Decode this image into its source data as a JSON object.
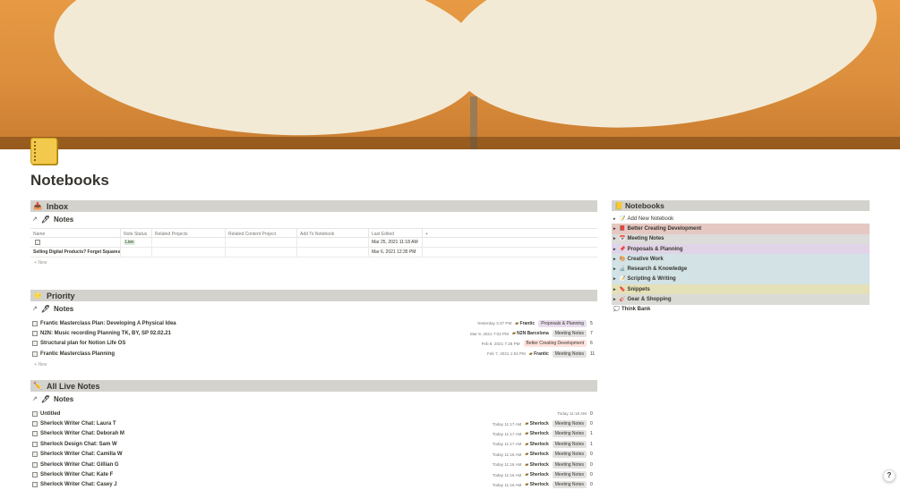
{
  "page": {
    "title": "Notebooks"
  },
  "inbox": {
    "heading": "Inbox",
    "heading_icon": "inbox-tray-icon",
    "view": "Notes",
    "columns": [
      "Name",
      "Note Status",
      "Related Projects",
      "Related Content Project",
      "Add To Notebook",
      "Last Edited"
    ],
    "rows": [
      {
        "name": "",
        "status": "Live",
        "edited": "Mar 25, 2021 11:18 AM"
      },
      {
        "name": "Selling Digital Products? Forget Squares",
        "status": "",
        "edited": "Mar 6, 2021 12:35 PM"
      }
    ],
    "new_label": "New"
  },
  "priority": {
    "heading": "Priority",
    "heading_icon": "star-icon",
    "view": "Notes",
    "rows": [
      {
        "title": "Frantic Masterclass Plan: Developing A Physical Idea",
        "date": "Yesterday 3:37 PM",
        "person": "Frantic",
        "tag": "Proposals & Planning",
        "tag_color": "#e8deee",
        "count": "5"
      },
      {
        "title": "N2N: Music recording Planning TK, BY, SP 02.02.21",
        "date": "Mar 9, 2021 7:02 PM",
        "person": "N2N Barcelona",
        "tag": "Meeting Notes",
        "tag_color": "#e3e2e0",
        "count": "7"
      },
      {
        "title": "Structural plan for Notion Life OS",
        "date": "Feb 8, 2021 7:28 PM",
        "person": "",
        "tag": "Better Creating Development",
        "tag_color": "#ffe2dd",
        "count": "6"
      },
      {
        "title": "Frantic Masterclass Planning",
        "date": "Feb 7, 2021 1:53 PM",
        "person": "Frantic",
        "tag": "Meeting Notes",
        "tag_color": "#e3e2e0",
        "count": "11"
      }
    ],
    "new_label": "New"
  },
  "all_live": {
    "heading": "All Live Notes",
    "heading_icon": "pencil-icon",
    "view": "Notes",
    "rows": [
      {
        "title": "Untitled",
        "date": "Today 11:18 AM",
        "person": "",
        "tag": "",
        "count": "0"
      },
      {
        "title": "Sherlock Writer Chat: Laura T",
        "date": "Today 11:17 AM",
        "person": "Sherlock",
        "tag": "Meeting Notes",
        "count": "0"
      },
      {
        "title": "Sherlock Writer Chat: Deborah M",
        "date": "Today 11:17 AM",
        "person": "Sherlock",
        "tag": "Meeting Notes",
        "count": "1"
      },
      {
        "title": "Sherlock Design Chat: Sam W",
        "date": "Today 11:17 AM",
        "person": "Sherlock",
        "tag": "Meeting Notes",
        "count": "1"
      },
      {
        "title": "Sherlock Writer Chat: Camilla W",
        "date": "Today 11:16 AM",
        "person": "Sherlock",
        "tag": "Meeting Notes",
        "count": "0"
      },
      {
        "title": "Sherlock Writer Chat: Gillian G",
        "date": "Today 11:16 AM",
        "person": "Sherlock",
        "tag": "Meeting Notes",
        "count": "0"
      },
      {
        "title": "Sherlock Writer Chat: Kate F",
        "date": "Today 11:16 AM",
        "person": "Sherlock",
        "tag": "Meeting Notes",
        "count": "0"
      },
      {
        "title": "Sherlock Writer Chat: Casey J",
        "date": "Today 11:16 AM",
        "person": "Sherlock",
        "tag": "Meeting Notes",
        "count": "0"
      }
    ]
  },
  "sidebar": {
    "heading": "Notebooks",
    "add_label": "Add New Notebook",
    "items": [
      {
        "label": "Better Creating Development",
        "bg": "#e5c8c2",
        "icon": "book-icon"
      },
      {
        "label": "Meeting Notes",
        "bg": "#dcdcda",
        "icon": "calendar-icon"
      },
      {
        "label": "Proposals & Planning",
        "bg": "#e1d4e8",
        "icon": "pushpin-icon"
      },
      {
        "label": "Creative Work",
        "bg": "#d2e2e5",
        "icon": "palette-icon"
      },
      {
        "label": "Research & Knowledge",
        "bg": "#d2e2e5",
        "icon": "microscope-icon"
      },
      {
        "label": "Scripting & Writing",
        "bg": "#d2e2e5",
        "icon": "memo-icon"
      },
      {
        "label": "Snippets",
        "bg": "#e4e1b8",
        "icon": "bookmark-icon"
      },
      {
        "label": "Gear & Shopping",
        "bg": "#dbdbd6",
        "icon": "guitar-icon"
      }
    ],
    "think_bank": "Think Bank"
  },
  "help": "?"
}
